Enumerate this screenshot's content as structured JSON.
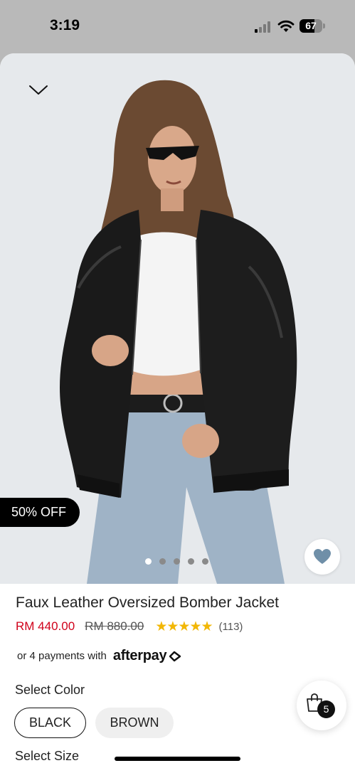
{
  "status_bar": {
    "time": "3:19",
    "battery_level": "67",
    "battery_fraction": 0.67
  },
  "icons": {
    "collapse": "chevron-down-icon",
    "signal": "cellular-signal-icon",
    "wifi": "wifi-icon",
    "battery": "battery-icon",
    "wishlist": "heart-icon",
    "cart": "shopping-bag-icon"
  },
  "product": {
    "discount_badge": "50% OFF",
    "title": "Faux Leather Oversized Bomber Jacket",
    "sale_price": "RM 440.00",
    "original_price": "RM 880.00",
    "rating_stars": "★★★★★",
    "rating": 5,
    "review_count": "(113)",
    "image_count": 5,
    "active_image_index": 0
  },
  "payment": {
    "text": "or 4 payments with",
    "provider": "afterpay"
  },
  "color_selector": {
    "label": "Select Color",
    "options": [
      {
        "label": "BLACK",
        "selected": true
      },
      {
        "label": "BROWN",
        "selected": false
      }
    ]
  },
  "size_selector": {
    "label": "Select Size"
  },
  "cart": {
    "count": "5"
  },
  "colors": {
    "sale_price": "#d0021b",
    "stars": "#f2b705",
    "image_background": "#e6e9ec",
    "heart": "#6f8fa8"
  }
}
